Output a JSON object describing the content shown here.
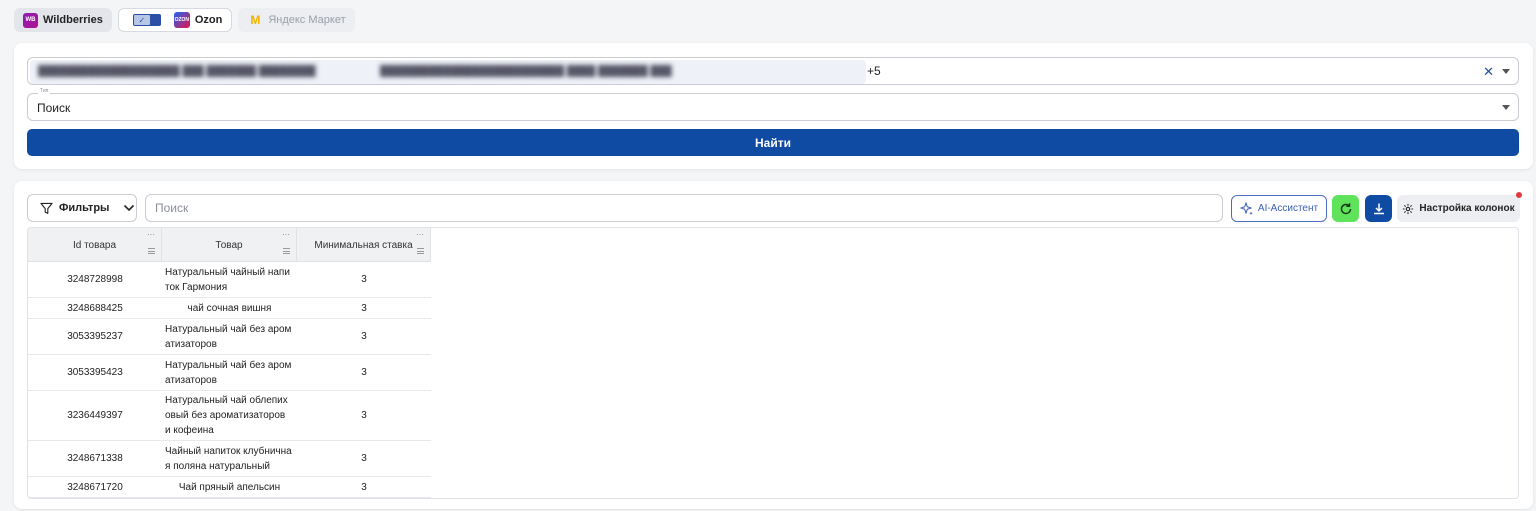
{
  "marketplaces": [
    {
      "label": "Wildberries",
      "logo_text": "WB",
      "active": true
    },
    {
      "label": "Ozon",
      "logo_text": "OZON",
      "active": true
    },
    {
      "label": "Яндекс Маркет",
      "active": false
    }
  ],
  "search_form": {
    "products_more_count": "+5",
    "type_label": "Тип",
    "type_value": "Поиск",
    "find_button": "Найти"
  },
  "toolbar": {
    "filters_label": "Фильтры",
    "search_placeholder": "Поиск",
    "ai_label": "AI-Ассистент",
    "columns_label": "Настройка колонок"
  },
  "table": {
    "columns": [
      "Id товара",
      "Товар",
      "Минимальная ставка"
    ],
    "rows": [
      {
        "id": "3248728998",
        "name_lines": [
          "Натуральный чайный напи",
          "ток Гармония"
        ],
        "bid": "3"
      },
      {
        "id": "3248688425",
        "name_lines": [
          "чай сочная вишня"
        ],
        "bid": "3"
      },
      {
        "id": "3053395237",
        "name_lines": [
          "Натуральный чай без аром",
          "атизаторов"
        ],
        "bid": "3"
      },
      {
        "id": "3053395423",
        "name_lines": [
          "Натуральный чай без аром",
          "атизаторов"
        ],
        "bid": "3"
      },
      {
        "id": "3236449397",
        "name_lines": [
          "Натуральный чай облепих",
          "овый без ароматизаторов",
          "и кофеина"
        ],
        "bid": "3"
      },
      {
        "id": "3248671338",
        "name_lines": [
          "Чайный напиток клубнична",
          "я поляна натуральный"
        ],
        "bid": "3"
      },
      {
        "id": "3248671720",
        "name_lines": [
          "Чай пряный апельсин"
        ],
        "bid": "3"
      }
    ]
  },
  "colors": {
    "primary": "#0f4aa3",
    "refresh_green": "#5fe35b",
    "notification_red": "#e23b3b"
  }
}
